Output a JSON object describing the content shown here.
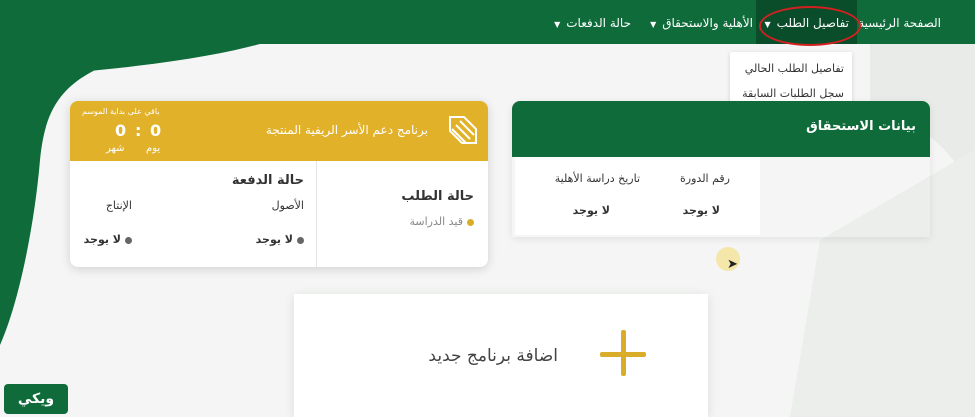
{
  "navbar": {
    "items": [
      {
        "label": "الصفحة الرئيسية"
      },
      {
        "label": "تفاصيل الطلب",
        "dropdown": true,
        "active": true
      },
      {
        "label": "الأهلية والاستحقاق",
        "dropdown": true
      },
      {
        "label": "حالة الدفعات",
        "dropdown": true
      }
    ]
  },
  "dropdown_menu": {
    "items": [
      "تفاصيل الطلب الحالي",
      "سجل الطلبات السابقة"
    ]
  },
  "eligibility": {
    "title": "بيانات الاستحقاق",
    "col_cycle": "رقم الدورة",
    "col_study_date": "تاريخ دراسة الأهلية",
    "cycle_value": "لا يوجد",
    "study_date_value": "لا يوجد"
  },
  "program": {
    "title": "برنامج دعم الأسر الريفية المنتجة",
    "countdown_label": "باقي على بداية الموسم",
    "days_value": "0",
    "days_unit": "يوم",
    "months_value": "0",
    "months_unit": "شهر",
    "separator": ":",
    "request_status_title": "حالة الطلب",
    "request_status_value": "قيد الدراسة",
    "payment_status_title": "حالة الدفعة",
    "assets_label": "الأصول",
    "production_label": "الإنتاج",
    "assets_value": "لا يوجد",
    "production_value": "لا يوجد"
  },
  "add_program": {
    "label": "اضافة برنامج جديد"
  },
  "watermark": {
    "text": "ويكي"
  },
  "colors": {
    "primary_green": "#0f6b3a",
    "gold": "#e2b12a",
    "annotation_red": "#d42020",
    "status_gold_dot": "#d9ad2a",
    "grey_dot": "#666666"
  }
}
